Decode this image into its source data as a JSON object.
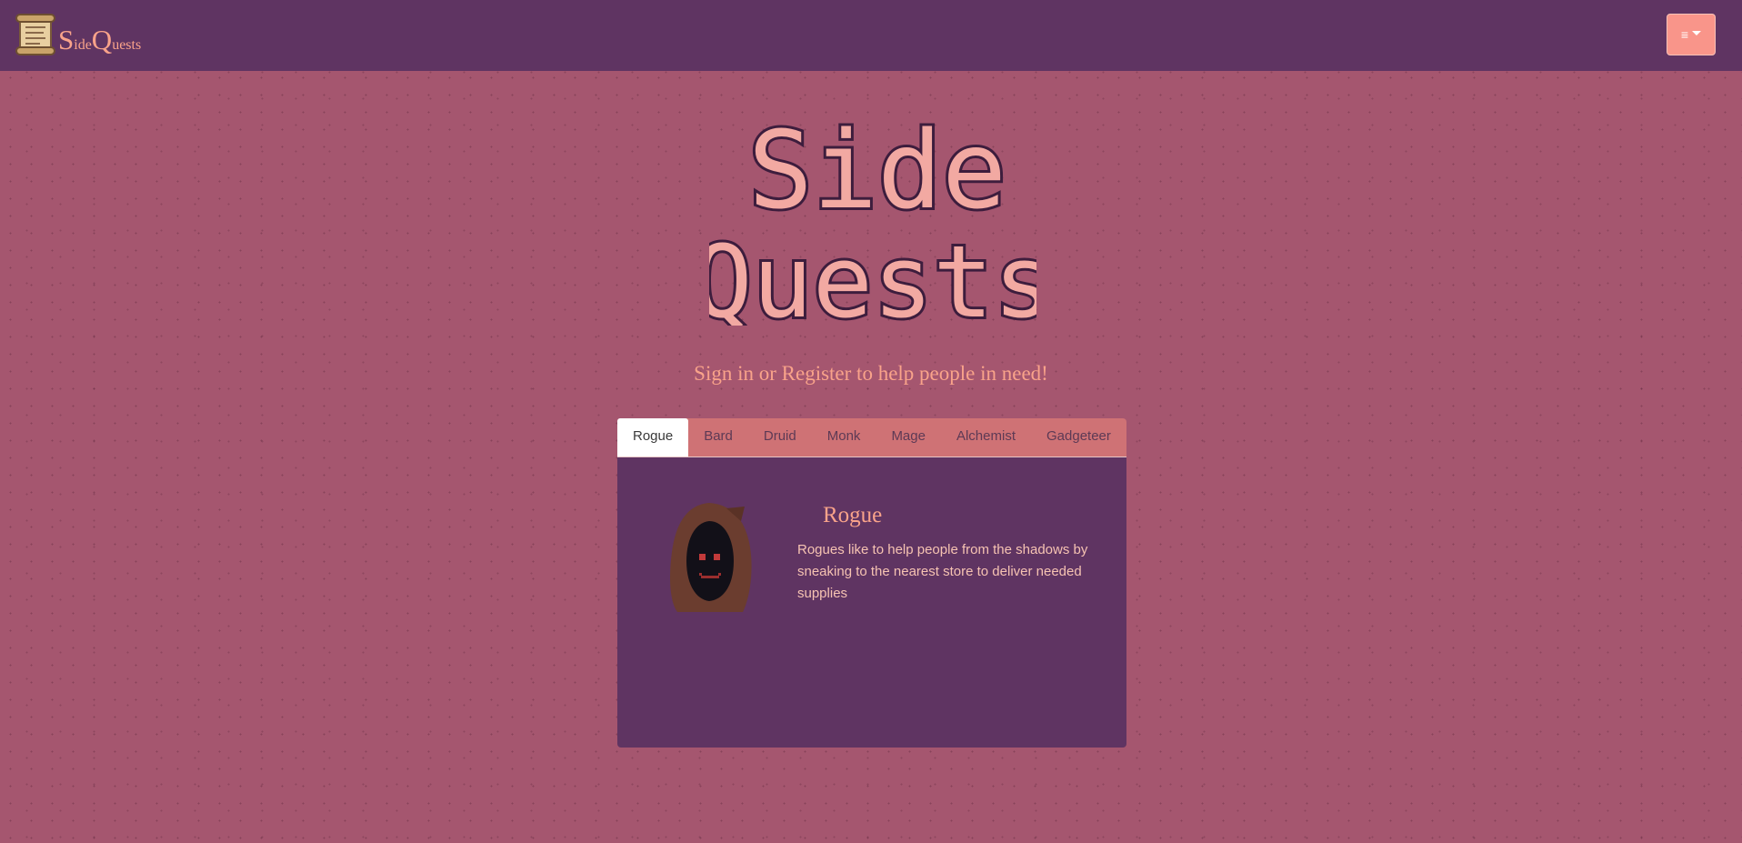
{
  "nav": {
    "brand": {
      "cap1": "S",
      "rest1": "ide",
      "cap2": "Q",
      "rest2": "uests",
      "icon": "scroll-icon"
    },
    "menu": {
      "icon": "hamburger-icon",
      "label": "≡"
    }
  },
  "hero": {
    "logo_line1": "Side",
    "logo_line2": "Quests",
    "tagline": "Sign in or Register to help people in need!"
  },
  "tabs": [
    {
      "label": "Rogue",
      "active": true
    },
    {
      "label": "Bard"
    },
    {
      "label": "Druid"
    },
    {
      "label": "Monk"
    },
    {
      "label": "Mage"
    },
    {
      "label": "Alchemist"
    },
    {
      "label": "Gadgeteer"
    }
  ],
  "panel": {
    "title": "Rogue",
    "description": "Rogues like to help people from the shadows by sneaking to the nearest store to deliver needed supplies",
    "image": "hooded-rogue-avatar"
  },
  "colors": {
    "background": "#a5566f",
    "navbar": "#5f3462",
    "accent": "#f9a38a",
    "tab_bar": "#cf7275",
    "menu_button": "#f9958a"
  }
}
